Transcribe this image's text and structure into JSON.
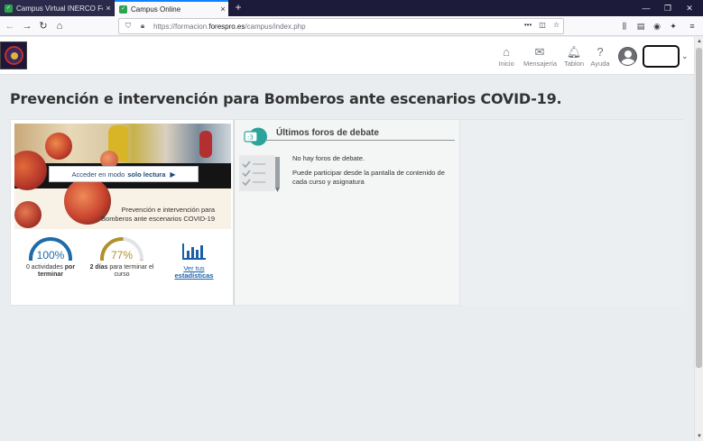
{
  "browser": {
    "tabs": [
      {
        "title": "Campus Virtual INERCO Foresp",
        "close": "×"
      },
      {
        "title": "Campus Online",
        "close": "×"
      }
    ],
    "new_tab": "+",
    "url": {
      "prefix": "https://formacion.",
      "host": "forespro.es",
      "path": "/campus/index.php"
    },
    "url_more": "•••"
  },
  "header": {
    "nav": [
      {
        "label": "Inicio",
        "icon": "home-icon"
      },
      {
        "label": "Mensajería",
        "icon": "envelope-icon"
      },
      {
        "label": "Tablon",
        "icon": "bell-icon"
      },
      {
        "label": "Ayuda",
        "icon": "help-icon"
      }
    ]
  },
  "page": {
    "title": "Prevención e intervención para Bomberos ante escenarios COVID-19."
  },
  "course_card": {
    "access_button": {
      "text": "Acceder en modo",
      "bold": "solo lectura"
    },
    "caption": [
      "Prevención e intervención para",
      "Bomberos ante escenarios COVID-19"
    ],
    "progress": {
      "value": "100%",
      "fraction": 1.0,
      "color": "#1e6ba8",
      "label_plain": "0 actividades",
      "label_bold": "por",
      "label_bold2": "terminar"
    },
    "time_left": {
      "value": "77%",
      "fraction": 0.77,
      "color": "#b0902a",
      "label_bold": "2 días",
      "label_plain": "para terminar el",
      "label_plain2": "curso"
    },
    "stats_link": [
      "Ver tus",
      "estadísticas"
    ]
  },
  "foros": {
    "title": "Últimos foros de debate",
    "empty": "No hay foros de debate.",
    "hint": "Puede participar desde la pantalla de contenido de cada curso y asignatura"
  }
}
